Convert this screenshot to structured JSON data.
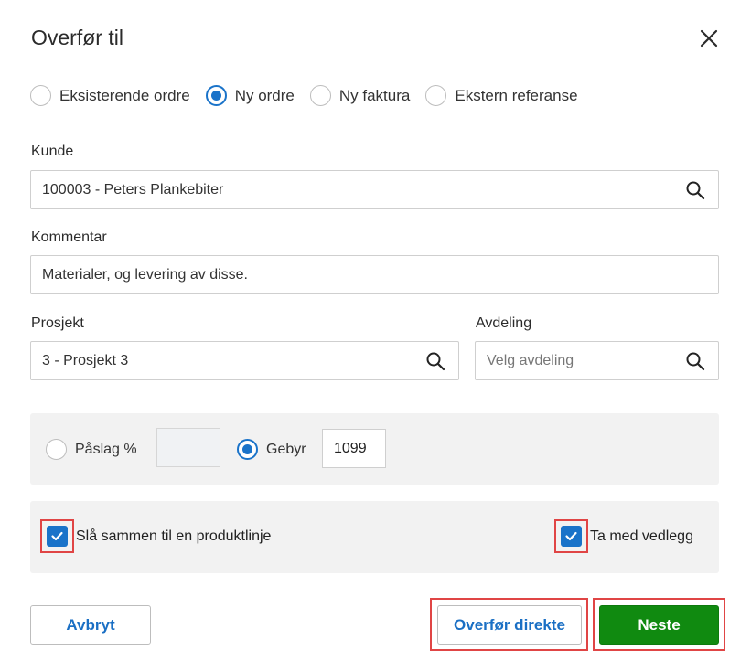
{
  "dialog": {
    "title": "Overfør til"
  },
  "target_options": [
    {
      "label": "Eksisterende ordre",
      "checked": false
    },
    {
      "label": "Ny ordre",
      "checked": true
    },
    {
      "label": "Ny faktura",
      "checked": false
    },
    {
      "label": "Ekstern referanse",
      "checked": false
    }
  ],
  "kunde": {
    "label": "Kunde",
    "value": "100003 - Peters Plankebiter"
  },
  "kommentar": {
    "label": "Kommentar",
    "value": "Materialer, og levering av disse."
  },
  "prosjekt": {
    "label": "Prosjekt",
    "value": "3 - Prosjekt 3"
  },
  "avdeling": {
    "label": "Avdeling",
    "placeholder": "Velg avdeling"
  },
  "pricing": {
    "paaslag_label": "Påslag %",
    "paaslag_checked": false,
    "paaslag_value": "",
    "gebyr_label": "Gebyr",
    "gebyr_checked": true,
    "gebyr_value": "1099"
  },
  "options": {
    "merge_label": "Slå sammen til en produktlinje",
    "merge_checked": true,
    "attachments_label": "Ta med vedlegg",
    "attachments_checked": true
  },
  "buttons": {
    "cancel": "Avbryt",
    "transfer_direct": "Overfør direkte",
    "next": "Neste"
  },
  "colors": {
    "accent": "#1a73c9",
    "primary_button": "#108a10",
    "highlight": "#e04545"
  }
}
